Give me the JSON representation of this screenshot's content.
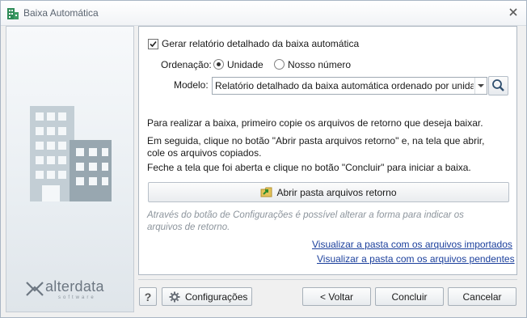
{
  "window": {
    "title": "Baixa Automática",
    "icon": "building-icon",
    "close_icon": "close-icon"
  },
  "brand": {
    "logo_text": "alterdata",
    "logo_sub": "software"
  },
  "options": {
    "detailed_report_label": "Gerar relatório detalhado da baixa automática",
    "detailed_report_checked": true,
    "order_label": "Ordenação:",
    "order_options": [
      "Unidade",
      "Nosso número"
    ],
    "order_selected": "Unidade",
    "model_label": "Modelo:",
    "model_value": "Relatório detalhado da baixa automática ordenado por unidade"
  },
  "instructions": {
    "line1": "Para realizar a baixa, primeiro copie os arquivos de retorno que deseja baixar.",
    "line2": "Em seguida, clique no botão \"Abrir pasta arquivos retorno\" e, na tela que abrir, cole os arquivos copiados.",
    "line3": "Feche a tela que foi aberta e clique no botão \"Concluir\" para iniciar a baixa."
  },
  "open_folder_button": "Abrir pasta arquivos retorno",
  "note": "Através do botão de Configurações é possível alterar a forma para indicar os arquivos de retorno.",
  "links": {
    "imported": "Visualizar a pasta com os arquivos importados",
    "pending": "Visualizar a pasta com os arquivos pendentes"
  },
  "footer": {
    "help_label": "?",
    "settings_label": "Configurações",
    "back_label": "< Voltar",
    "finish_label": "Concluir",
    "cancel_label": "Cancelar"
  },
  "colors": {
    "link": "#1b3f9c",
    "note": "#8c949c",
    "building": "#a8b6bf"
  }
}
